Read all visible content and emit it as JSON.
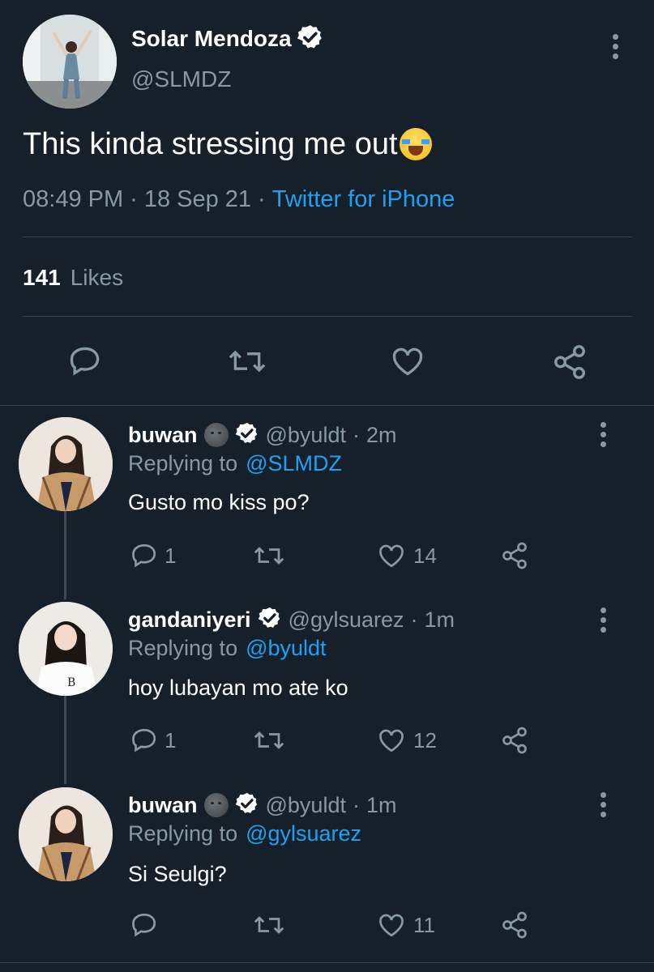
{
  "tweet": {
    "author_name": "Solar Mendoza",
    "handle": "@SLMDZ",
    "text": "This kinda stressing me out",
    "time": "08:49 PM",
    "date": "18 Sep 21",
    "source": "Twitter for iPhone",
    "likes_count": "141",
    "likes_label": "Likes",
    "verified_icon": "verified-badge",
    "emoji": "loudly-crying-face"
  },
  "replies": [
    {
      "name": "buwan",
      "handle": "@byuldt",
      "time": "2m",
      "replying_label": "Replying to",
      "replying_to": "@SLMDZ",
      "text": "Gusto mo kiss po?",
      "replies": "1",
      "likes": "14",
      "name_emoji": "new-moon-face"
    },
    {
      "name": "gandaniyeri",
      "handle": "@gylsuarez",
      "time": "1m",
      "replying_label": "Replying to",
      "replying_to": "@byuldt",
      "text": "hoy lubayan mo ate ko",
      "replies": "1",
      "likes": "12"
    },
    {
      "name": "buwan",
      "handle": "@byuldt",
      "time": "1m",
      "replying_label": "Replying to",
      "replying_to": "@gylsuarez",
      "text": "Si Seulgi?",
      "replies": "",
      "likes": "11",
      "name_emoji": "new-moon-face"
    }
  ],
  "separator": "·",
  "colors": {
    "background": "#15202b",
    "muted": "#8899a6",
    "link": "#1da1f2",
    "divider": "#38444d"
  }
}
